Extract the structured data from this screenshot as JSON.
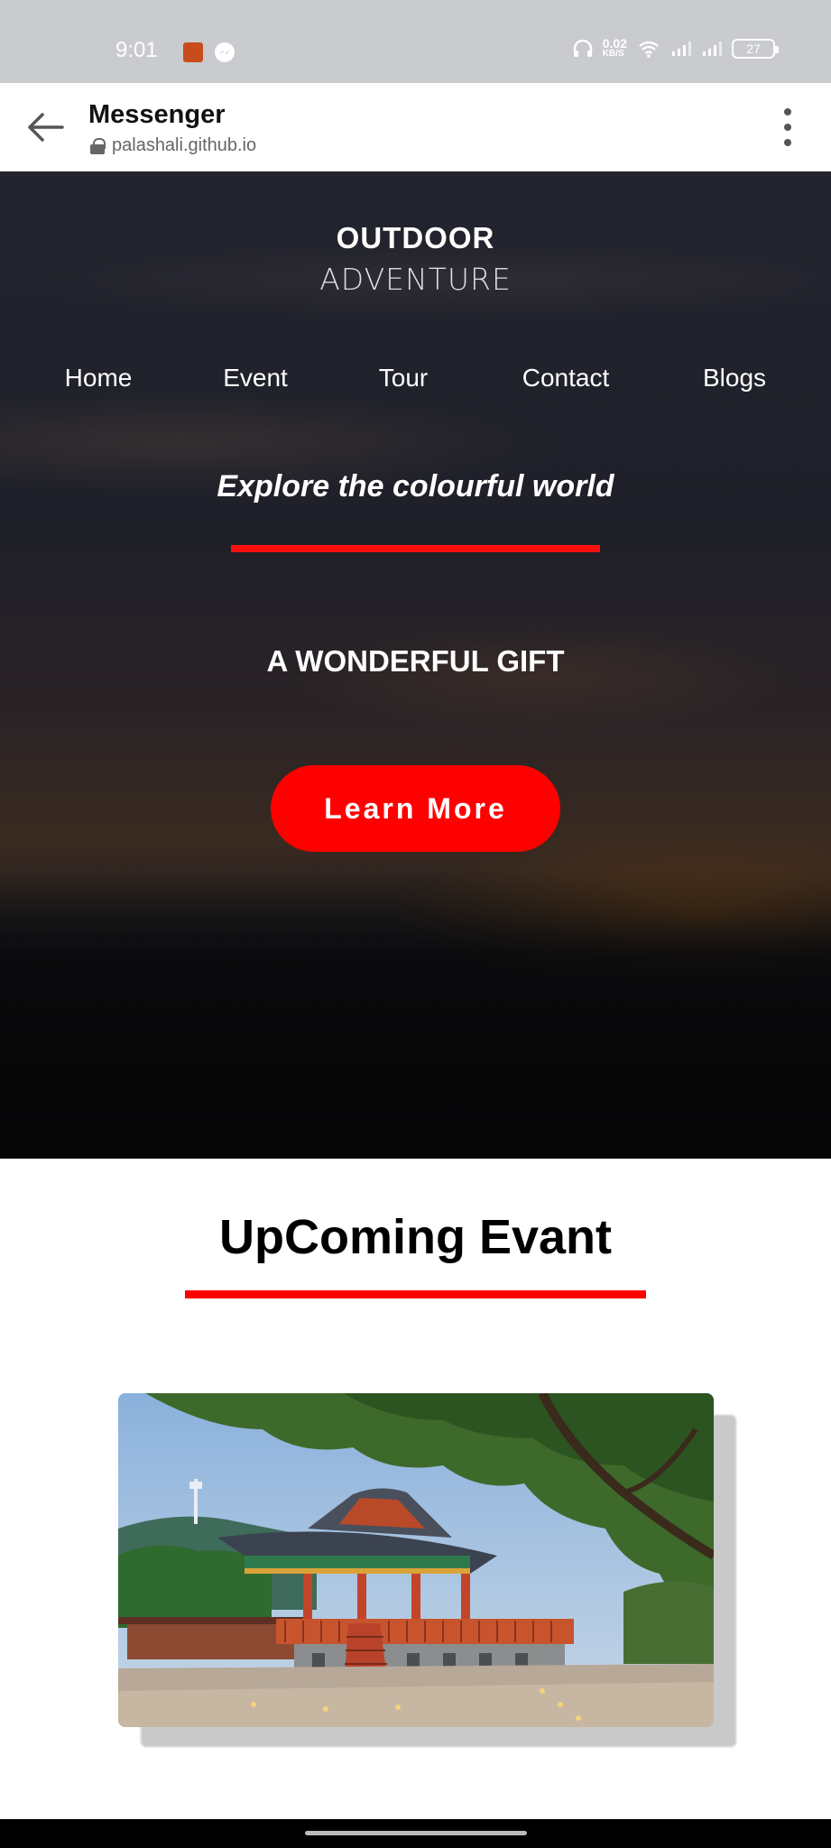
{
  "status_bar": {
    "time": "9:01",
    "net_speed": "0.02",
    "net_unit": "KB/S",
    "battery": "27",
    "icons": [
      "sim-app-icon",
      "messenger-icon",
      "headphones-icon",
      "wifi-icon",
      "signal-icon",
      "signal-icon-2",
      "battery-icon"
    ]
  },
  "browser": {
    "title": "Messenger",
    "url": "palashali.github.io"
  },
  "hero": {
    "logo_top": "OUTDOOR",
    "logo_bottom": "ADVENTURE",
    "nav": [
      "Home",
      "Event",
      "Tour",
      "Contact",
      "Blogs"
    ],
    "tagline": "Explore the colourful world",
    "gift": "A WONDERFUL GIFT",
    "cta": "Learn More"
  },
  "events": {
    "title": "UpComing Evant",
    "image_icon": "pavilion-image"
  },
  "colors": {
    "accent": "#ff0000",
    "status_bar_bg": "#c9cbcf"
  }
}
